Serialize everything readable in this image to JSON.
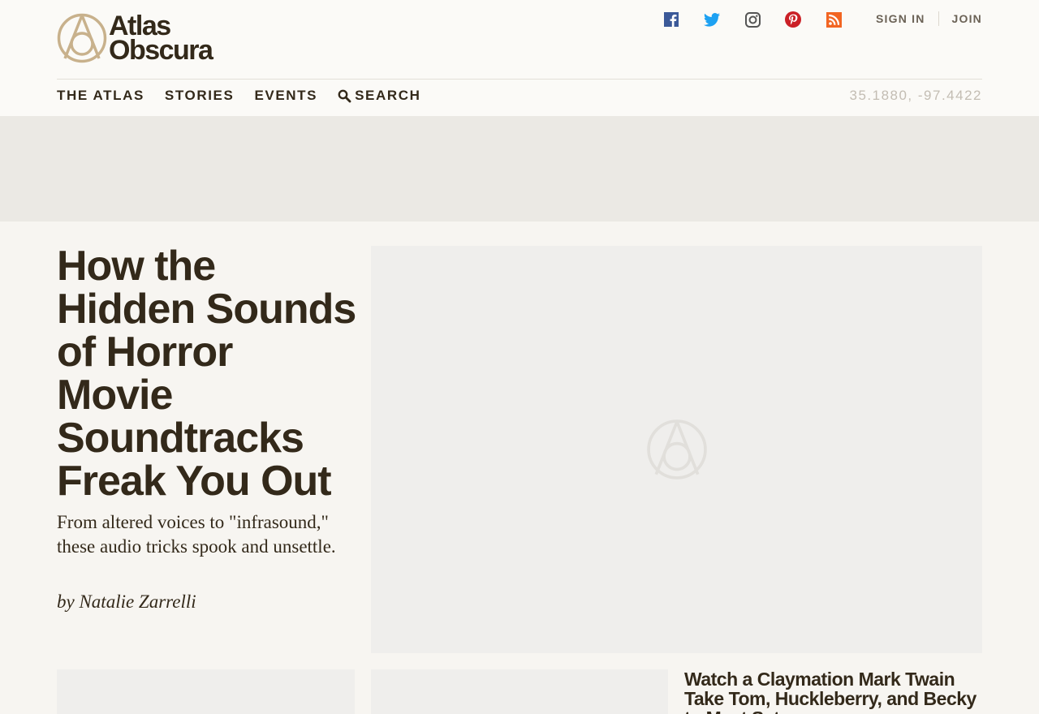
{
  "brand": {
    "name_line1": "Atlas",
    "name_line2": "Obscura",
    "color": "#c8b18c"
  },
  "social": [
    {
      "name": "facebook-icon",
      "color": "#3b5998"
    },
    {
      "name": "twitter-icon",
      "color": "#1da1f2"
    },
    {
      "name": "instagram-icon",
      "color": "#555555"
    },
    {
      "name": "pinterest-icon",
      "color": "#cb2027"
    },
    {
      "name": "rss-icon",
      "color": "#f26522"
    }
  ],
  "auth": {
    "sign_in": "SIGN IN",
    "join": "JOIN"
  },
  "nav": {
    "atlas": "THE ATLAS",
    "stories": "STORIES",
    "events": "EVENTS",
    "search": "SEARCH"
  },
  "coordinates": "35.1880, -97.4422",
  "article": {
    "title": "How the Hidden Sounds of Horror Movie Soundtracks Freak You Out",
    "dek": "From altered voices to \"infrasound,\" these audio tricks spook and unsettle.",
    "byline": "by Natalie Zarrelli"
  },
  "related": {
    "title": "Watch a Claymation Mark Twain Take Tom, Huckleberry, and Becky to Meet Satan"
  }
}
